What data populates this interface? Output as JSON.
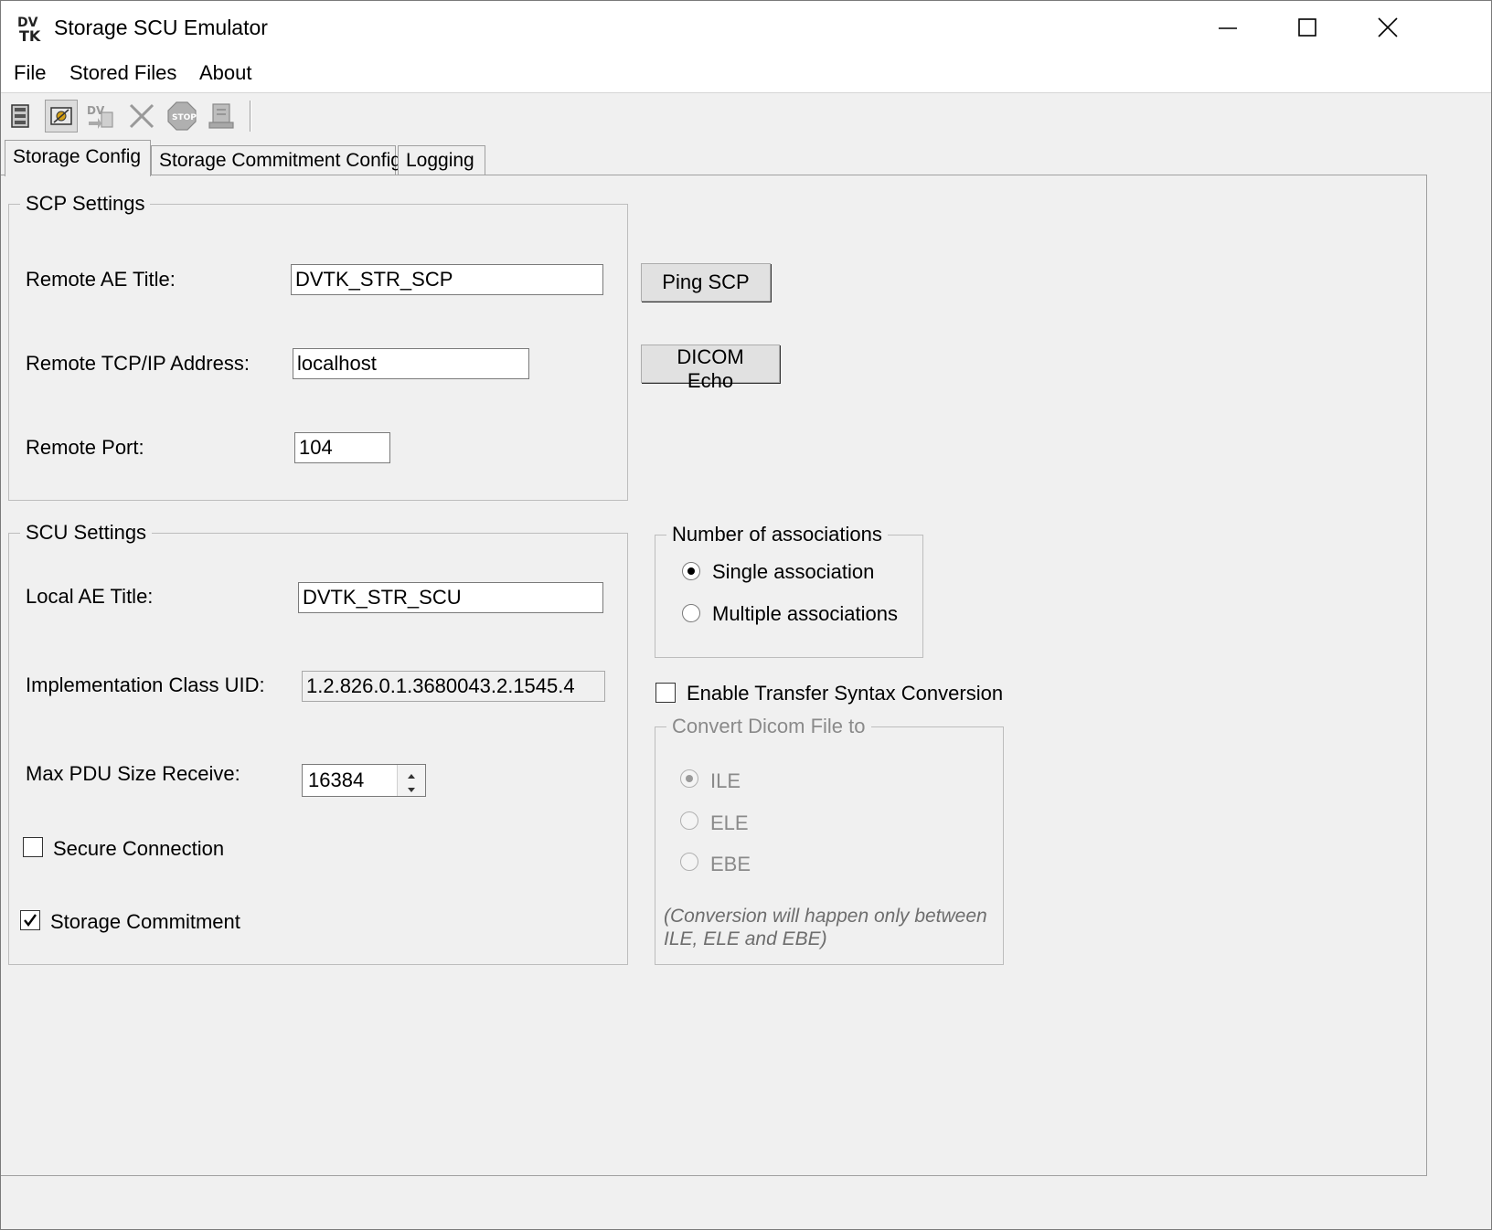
{
  "window": {
    "title": "Storage SCU Emulator",
    "controls": [
      "minimize",
      "maximize",
      "close"
    ]
  },
  "menu": [
    "File",
    "Stored Files",
    "About"
  ],
  "toolbar": {
    "icons": [
      "database-icon",
      "config-icon",
      "send-icon",
      "delete-icon",
      "stop-icon",
      "export-icon"
    ]
  },
  "tabs": [
    "Storage Config",
    "Storage Commitment Config",
    "Logging"
  ],
  "active_tab": "Storage Config",
  "scp": {
    "legend": "SCP Settings",
    "remote_ae_label": "Remote AE Title:",
    "remote_ae_value": "DVTK_STR_SCP",
    "ip_label": "Remote TCP/IP Address:",
    "ip_value": "localhost",
    "port_label": "Remote Port:",
    "port_value": "104",
    "ping_button": "Ping SCP",
    "echo_button": "DICOM Echo"
  },
  "scu": {
    "legend": "SCU Settings",
    "local_ae_label": "Local AE Title:",
    "local_ae_value": "DVTK_STR_SCU",
    "impl_uid_label": "Implementation Class UID:",
    "impl_uid_value": "1.2.826.0.1.3680043.2.1545.4",
    "pdu_label": "Max PDU Size Receive:",
    "pdu_value": "16384",
    "secure_label": "Secure Connection",
    "secure_checked": false,
    "commit_label": "Storage Commitment",
    "commit_checked": true
  },
  "associations": {
    "legend": "Number of associations",
    "single": "Single association",
    "multiple": "Multiple associations",
    "selected": "single"
  },
  "conversion": {
    "enable_label": "Enable Transfer Syntax Conversion",
    "enabled": false,
    "legend": "Convert Dicom File to",
    "options": [
      "ILE",
      "ELE",
      "EBE"
    ],
    "selected": "ILE",
    "note": "(Conversion will happen only between ILE, ELE and EBE)"
  }
}
